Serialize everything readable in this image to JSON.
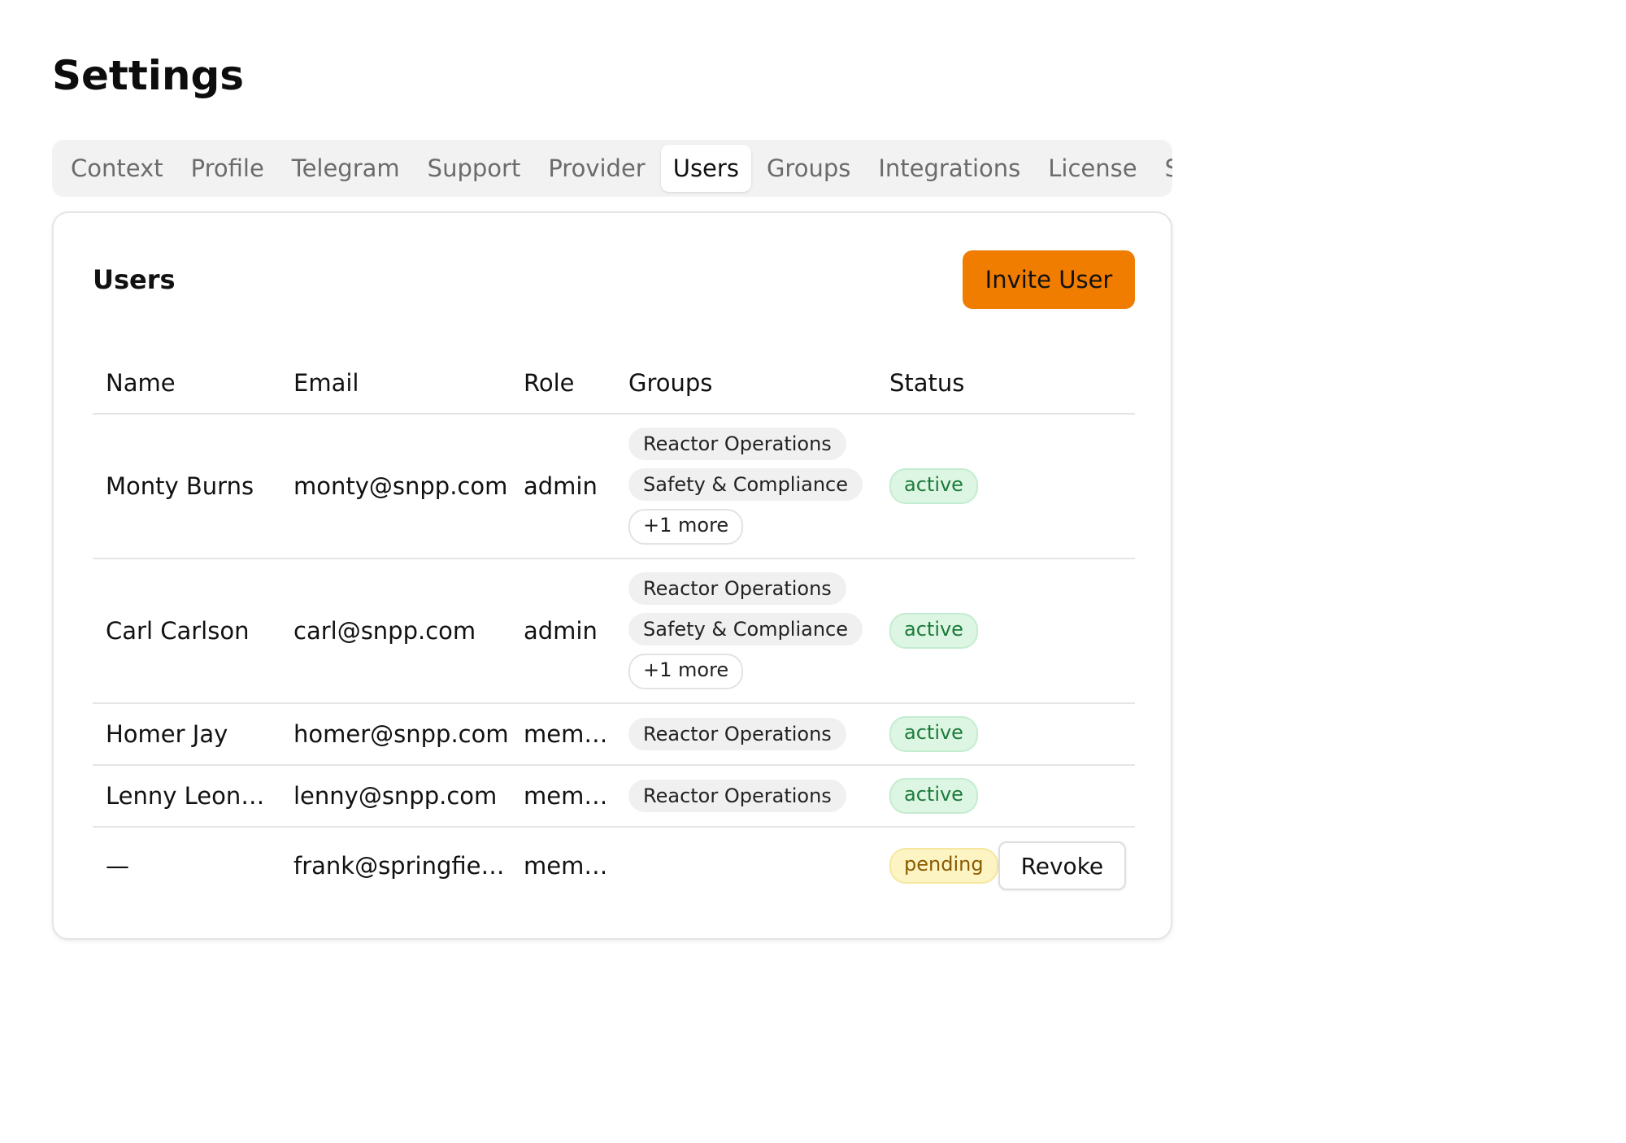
{
  "page": {
    "title": "Settings"
  },
  "tabs": [
    {
      "label": "Context",
      "active": false
    },
    {
      "label": "Profile",
      "active": false
    },
    {
      "label": "Telegram",
      "active": false
    },
    {
      "label": "Support",
      "active": false
    },
    {
      "label": "Provider",
      "active": false
    },
    {
      "label": "Users",
      "active": true
    },
    {
      "label": "Groups",
      "active": false
    },
    {
      "label": "Integrations",
      "active": false
    },
    {
      "label": "License",
      "active": false
    },
    {
      "label": "Security",
      "active": false
    }
  ],
  "users_panel": {
    "title": "Users",
    "invite_label": "Invite User",
    "columns": [
      "Name",
      "Email",
      "Role",
      "Groups",
      "Status"
    ],
    "rows": [
      {
        "name": "Monty Burns",
        "email": "monty@snpp.com",
        "role": "admin",
        "groups": [
          "Reactor Operations",
          "Safety & Compliance"
        ],
        "more": "+1 more",
        "status": "active"
      },
      {
        "name": "Carl Carlson",
        "email": "carl@snpp.com",
        "role": "admin",
        "groups": [
          "Reactor Operations",
          "Safety & Compliance"
        ],
        "more": "+1 more",
        "status": "active"
      },
      {
        "name": "Homer Jay",
        "email": "homer@snpp.com",
        "role": "member",
        "groups": [
          "Reactor Operations"
        ],
        "status": "active"
      },
      {
        "name": "Lenny Leon…",
        "email": "lenny@snpp.com",
        "role": "member",
        "groups": [
          "Reactor Operations"
        ],
        "status": "active"
      },
      {
        "name": "—",
        "email": "frank@springfie…",
        "role": "member",
        "groups": [],
        "status": "pending",
        "action_label": "Revoke"
      }
    ]
  },
  "colors": {
    "accent": "#f07c00",
    "active_badge_bg": "#ddf6e4",
    "active_badge_text": "#1d7a3a",
    "pending_badge_bg": "#fdf4c3",
    "pending_badge_text": "#8a5a00"
  }
}
